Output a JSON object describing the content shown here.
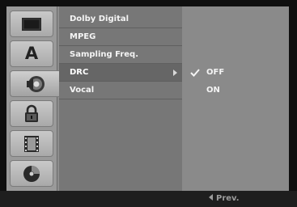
{
  "icons": [
    {
      "name": "disc-tray-icon"
    },
    {
      "name": "language-icon",
      "glyph": "A"
    },
    {
      "name": "audio-speaker-icon"
    },
    {
      "name": "lock-icon"
    },
    {
      "name": "film-icon"
    },
    {
      "name": "disc-icon"
    }
  ],
  "selected_icon": 2,
  "menu": {
    "items": [
      {
        "label": "Dolby Digital"
      },
      {
        "label": "MPEG"
      },
      {
        "label": "Sampling Freq."
      },
      {
        "label": "DRC"
      },
      {
        "label": "Vocal"
      }
    ],
    "selected_index": 3
  },
  "options": [
    {
      "label": "OFF",
      "checked": true
    },
    {
      "label": "ON",
      "checked": false
    }
  ],
  "footer": {
    "prev_label": "Prev."
  },
  "colors": {
    "frame": "#0f0f0f",
    "menu_bg": "#777777",
    "option_bg": "#8a8a8a",
    "bottom_bar": "#1e1e1e",
    "text": "#f4f4f4"
  }
}
